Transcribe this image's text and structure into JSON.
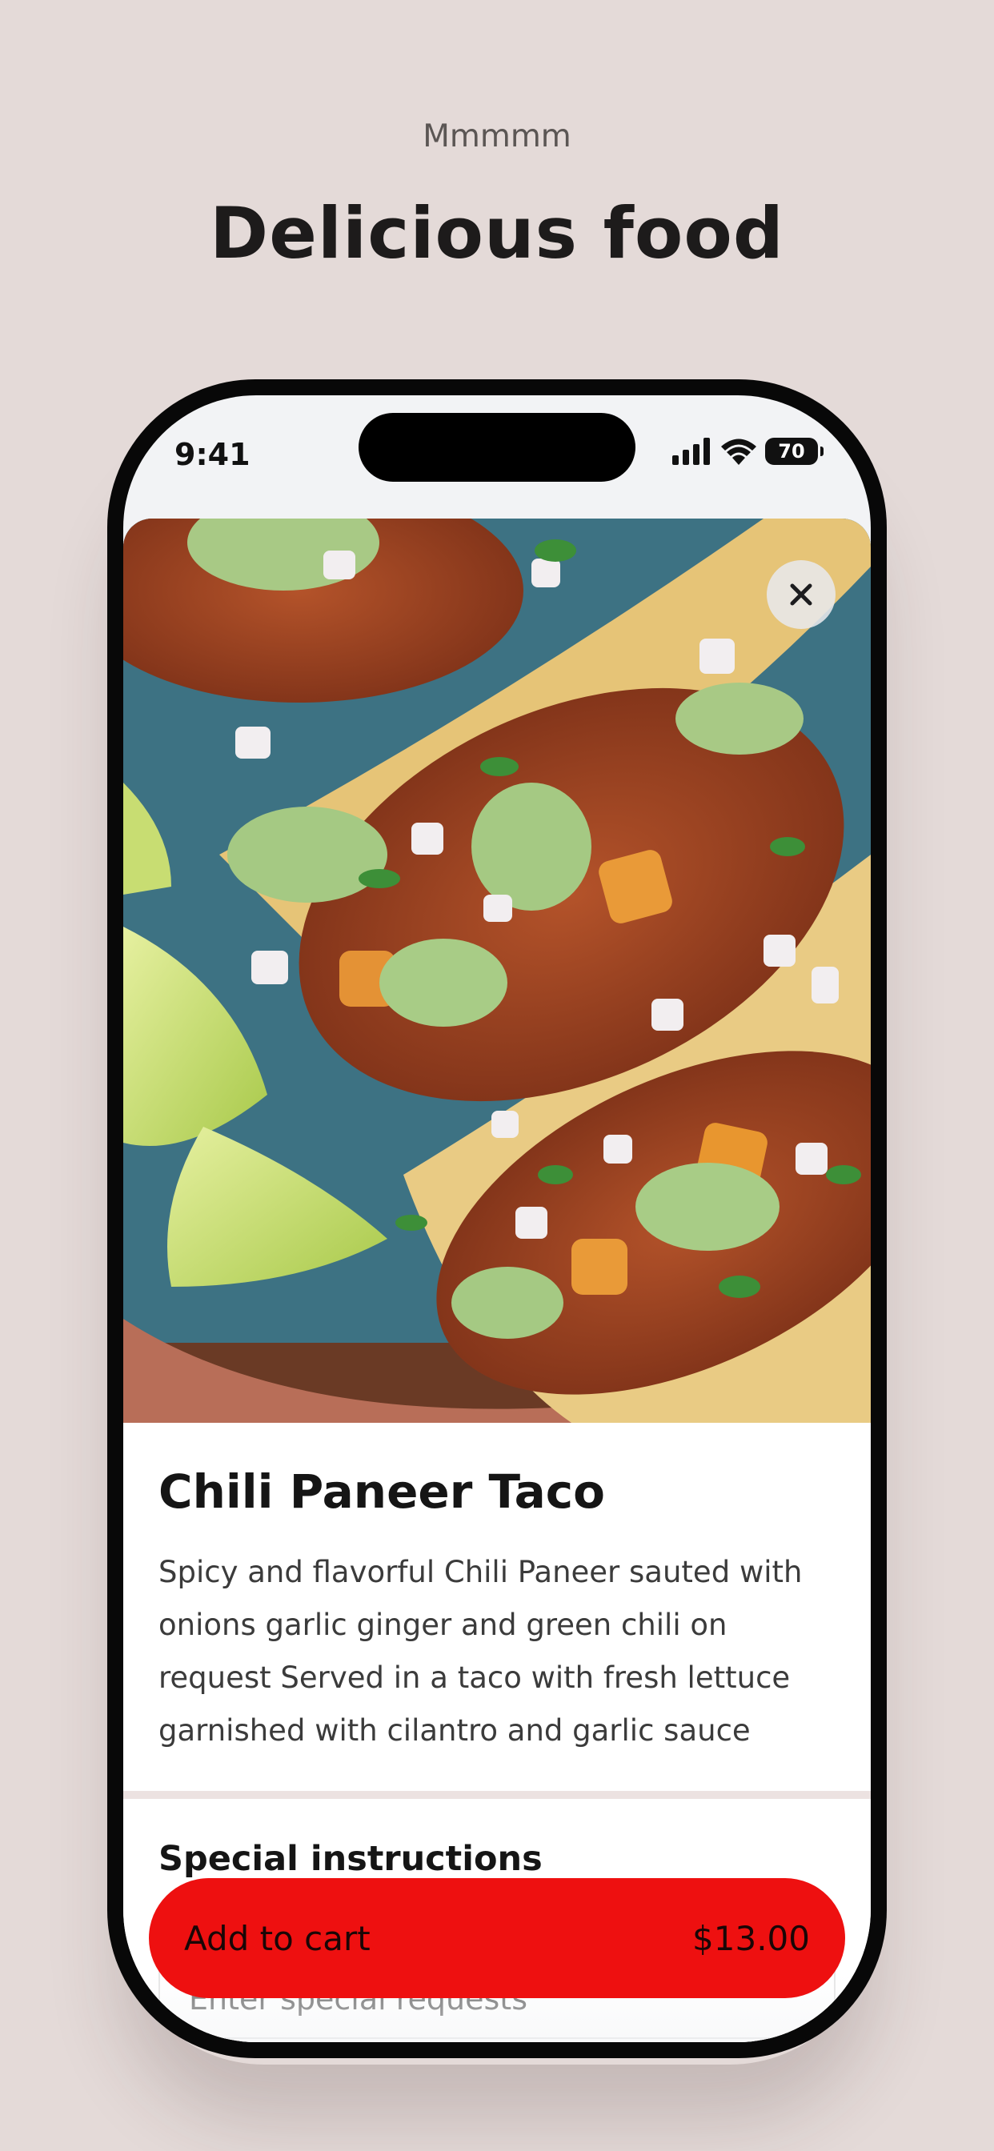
{
  "promo": {
    "eyebrow": "Mmmmm",
    "title": "Delicious food"
  },
  "status_bar": {
    "time": "9:41",
    "battery": "70",
    "icons": [
      "signal-icon",
      "wifi-icon",
      "battery-icon"
    ]
  },
  "item": {
    "image_icon": "taco-photo",
    "title": "Chili Paneer Taco",
    "description": "Spicy and flavorful Chili Paneer sauted with onions garlic ginger and green chili on request Served in a taco with fresh lettuce garnished with cilantro and garlic sauce"
  },
  "special_instructions": {
    "title": "Special instructions",
    "placeholder": "Enter special requests"
  },
  "cart": {
    "label": "Add to cart",
    "price": "$13.00"
  },
  "colors": {
    "background": "#e4dad8",
    "accent": "#ee1010",
    "plate": "#3c6f80"
  }
}
